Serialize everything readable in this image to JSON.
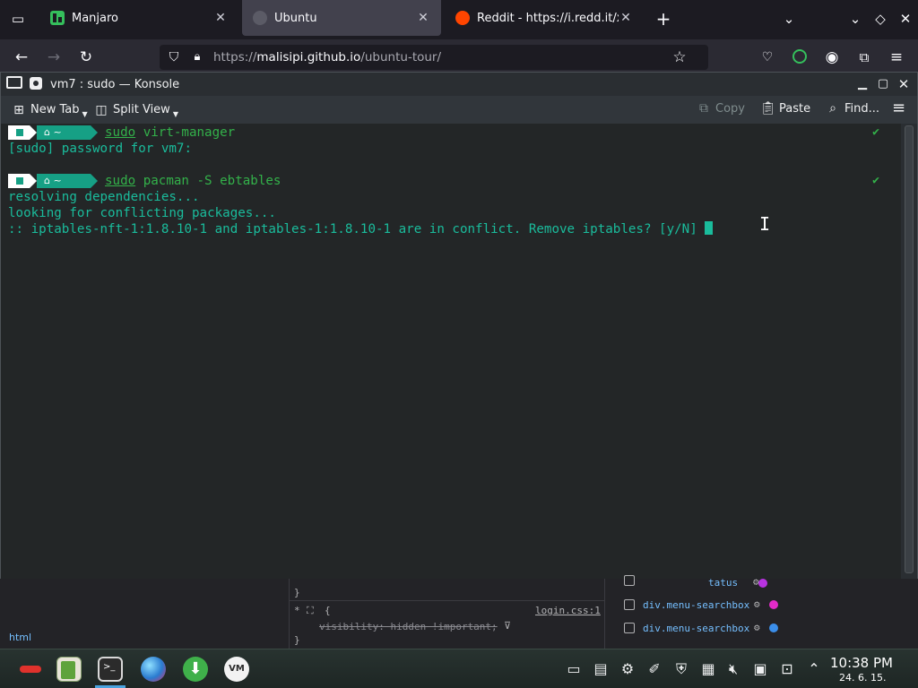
{
  "browser": {
    "tabs": [
      {
        "label": "Manjaro",
        "active": false
      },
      {
        "label": "Ubuntu",
        "active": true
      },
      {
        "label": "Reddit - https://i.redd.it/xo",
        "active": false
      }
    ],
    "url": {
      "prefix": "https://",
      "host": "malisipi.github.io",
      "path": "/ubuntu-tour/"
    }
  },
  "konsole": {
    "title": "vm7 : sudo — Konsole",
    "toolbar": {
      "new_tab": "New Tab",
      "split_view": "Split View",
      "copy": "Copy",
      "paste": "Paste",
      "find": "Find..."
    },
    "prompt": {
      "home": "~"
    },
    "lines": {
      "cmd1_sudo": "sudo",
      "cmd1_rest": " virt-manager",
      "out1": "[sudo] password for vm7:",
      "cmd2_sudo": "sudo",
      "cmd2_rest": " pacman -S ebtables",
      "out2": "resolving dependencies...",
      "out3": "looking for conflicting packages...",
      "out4": ":: iptables-nft-1:1.8.10-1 and iptables-1:1.8.10-1 are in conflict. Remove iptables? [y/N] "
    },
    "check": "✔"
  },
  "devtools": {
    "rule_line1": "tatus",
    "brace_close": "}",
    "rule_star": "*",
    "rule_open": "{",
    "rule_prop": "visibility: hidden !important;",
    "rule_source": "login.css:1",
    "selector1": "div.menu-searchbox",
    "selector2": "div.menu-searchbox",
    "breadcrumb": "html",
    "colors": {
      "purple": "#b833e1",
      "magenta": "#e22bc8",
      "blue": "#3b8eea"
    }
  },
  "taskbar": {
    "time": "10:38 PM",
    "date": "24. 6. 15."
  }
}
